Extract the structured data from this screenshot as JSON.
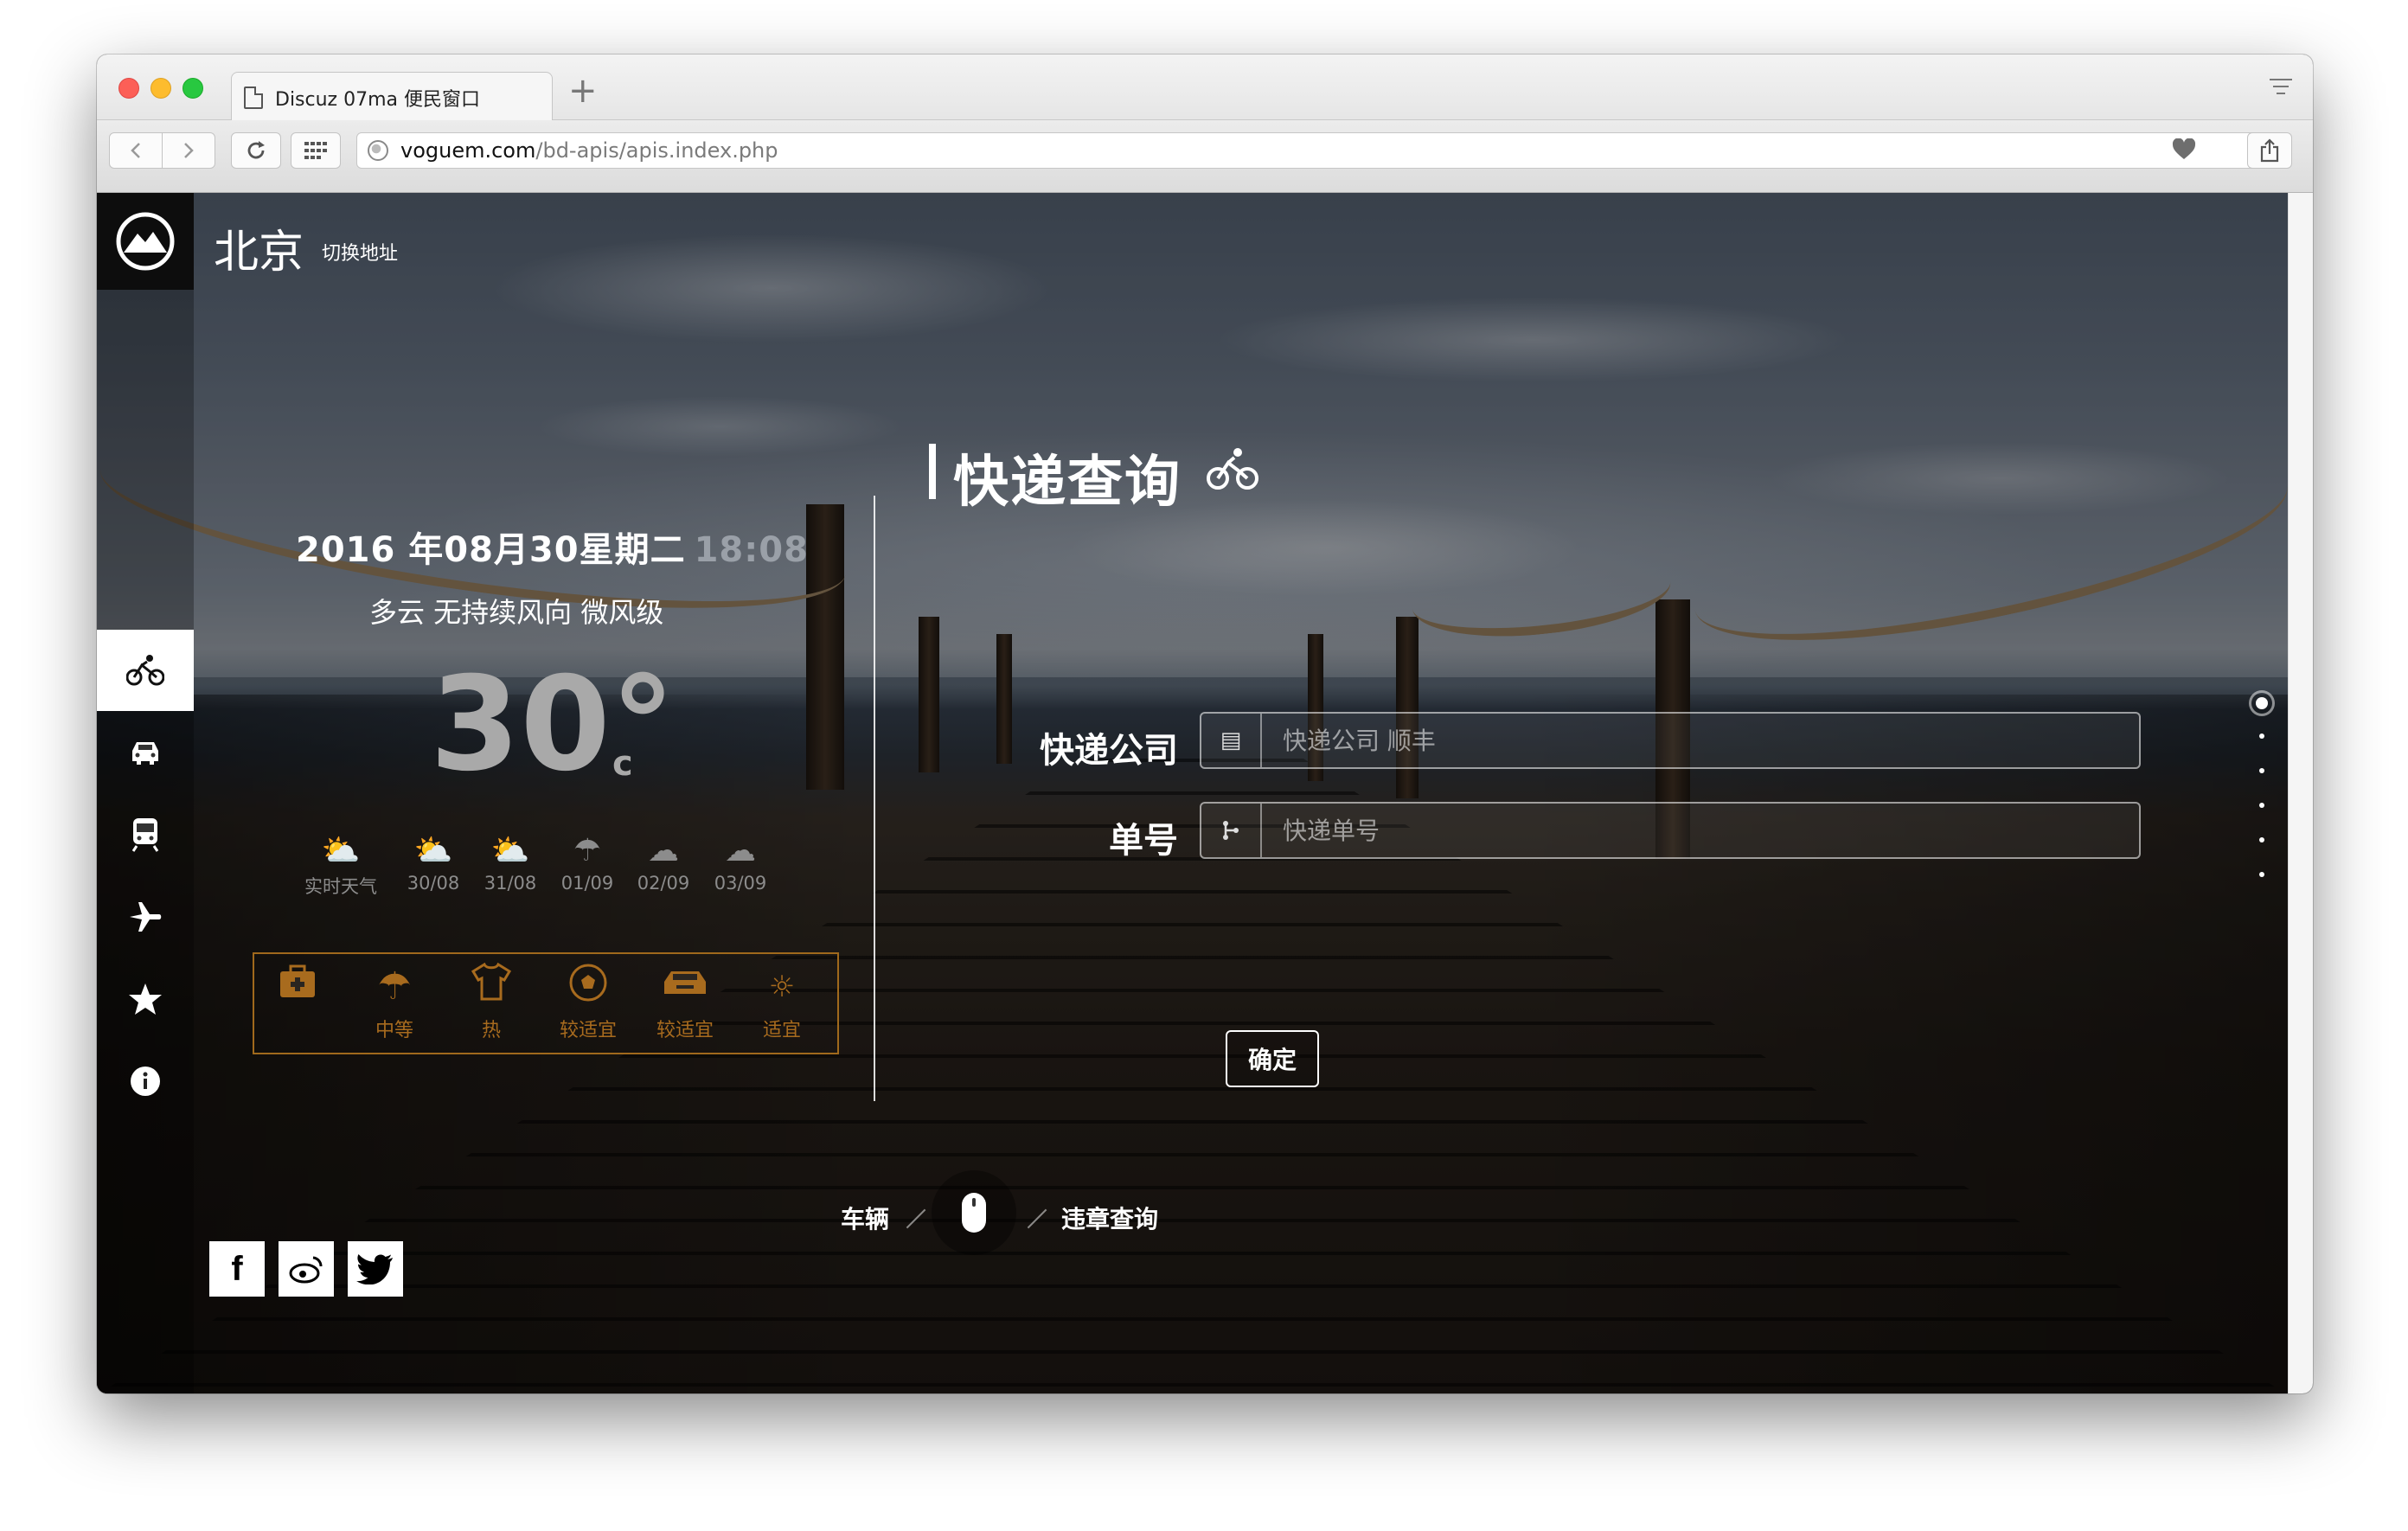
{
  "browser": {
    "tab_title": "Discuz 07ma 便民窗口",
    "new_tab": "+",
    "url_host": "voguem.com",
    "url_path": "/bd-apis/apis.index.php"
  },
  "header": {
    "city": "北京",
    "switch_label": "切换地址"
  },
  "sidebar": {
    "items": [
      {
        "icon": "bicycle-icon",
        "active": true
      },
      {
        "icon": "car-icon",
        "active": false
      },
      {
        "icon": "train-icon",
        "active": false
      },
      {
        "icon": "airplane-icon",
        "active": false
      },
      {
        "icon": "star-icon",
        "active": false
      },
      {
        "icon": "info-icon",
        "active": false
      }
    ]
  },
  "weather": {
    "date": "2016 年08月30星期二",
    "time": "18:08",
    "description": "多云  无持续风向 微风级",
    "temperature": "30°",
    "unit": "c",
    "forecast": [
      {
        "label": "实时天气",
        "icon": "partly-cloudy-icon"
      },
      {
        "label": "30/08",
        "icon": "partly-cloudy-icon"
      },
      {
        "label": "31/08",
        "icon": "partly-cloudy-icon"
      },
      {
        "label": "01/09",
        "icon": "rain-icon"
      },
      {
        "label": "02/09",
        "icon": "thunder-icon"
      },
      {
        "label": "03/09",
        "icon": "cloudy-icon"
      }
    ],
    "life_index": [
      {
        "label": "",
        "icon": "first-aid-icon"
      },
      {
        "label": "中等",
        "icon": "umbrella-icon"
      },
      {
        "label": "热",
        "icon": "tshirt-icon"
      },
      {
        "label": "较适宜",
        "icon": "ball-icon"
      },
      {
        "label": "较适宜",
        "icon": "car-wash-icon"
      },
      {
        "label": "适宜",
        "icon": "sun-icon"
      }
    ],
    "accent_color": "#a86b1e"
  },
  "express": {
    "title": "快递查询",
    "company_label": "快递公司",
    "company_placeholder": "快递公司 顺丰",
    "number_label": "单号",
    "number_placeholder": "快递单号",
    "confirm_label": "确定"
  },
  "bottom_nav": {
    "left_label": "车辆",
    "right_label": "违章查询"
  },
  "social": [
    {
      "icon": "facebook-icon",
      "glyph": "f"
    },
    {
      "icon": "weibo-icon",
      "glyph": "微"
    },
    {
      "icon": "twitter-icon",
      "glyph": "t"
    }
  ]
}
